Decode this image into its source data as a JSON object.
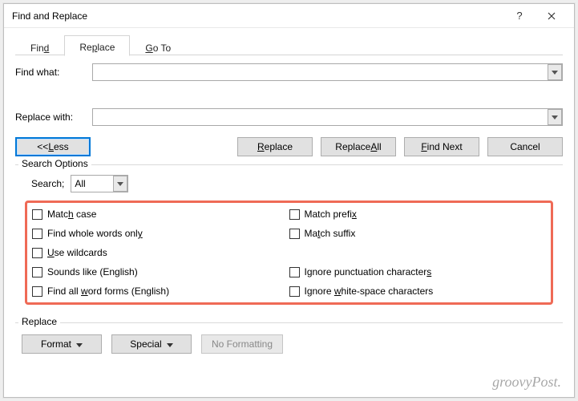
{
  "title": "Find and Replace",
  "tabs": {
    "find": "Find",
    "replace": "Replace",
    "goto": "Go To"
  },
  "labels": {
    "find_what": "Find what:",
    "replace_with": "Replace with:"
  },
  "fields": {
    "find_what_value": "",
    "replace_with_value": ""
  },
  "buttons": {
    "less_lead": "<< ",
    "less_u": "L",
    "less_tail": "ess",
    "replace_u": "R",
    "replace_tail": "eplace",
    "replace_all_lead": "Replace ",
    "replace_all_u": "A",
    "replace_all_tail": "ll",
    "find_next_u": "F",
    "find_next_tail": "ind Next",
    "cancel": "Cancel"
  },
  "search_options": {
    "legend": "Search Options",
    "search_label": "Search;",
    "search_value": "All"
  },
  "checks": {
    "match_case_lead": "Matc",
    "match_case_u": "h",
    "match_case_tail": " case",
    "whole_words_lead": "Find whole words onl",
    "whole_words_u": "y",
    "wildcards_u": "U",
    "wildcards_tail": "se wildcards",
    "sounds_like": "Sounds like (English)",
    "word_forms_lead": "Find all ",
    "word_forms_u": "w",
    "word_forms_tail": "ord forms (English)",
    "match_prefix_lead": "Match prefi",
    "match_prefix_u": "x",
    "match_suffix_lead": "Ma",
    "match_suffix_u": "t",
    "match_suffix_tail": "ch suffix",
    "ignore_punct_lead": "Ignore punctuation character",
    "ignore_punct_u": "s",
    "ignore_ws_lead": "Ignore ",
    "ignore_ws_u": "w",
    "ignore_ws_tail": "hite-space characters"
  },
  "replace_group": {
    "legend": "Replace",
    "format_label": "Format",
    "special_lead": "Sp",
    "special_u": "e",
    "special_tail": "cial",
    "no_formatting": "No Formatting"
  },
  "watermark": "groovyPost."
}
